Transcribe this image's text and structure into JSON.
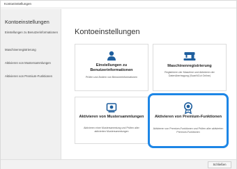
{
  "window": {
    "title": "Kontoeinstellungen"
  },
  "sidebar": {
    "title": "Kontoeinstellungen",
    "items": [
      {
        "label": "Einstellungen zu Benutzerinformationen"
      },
      {
        "label": "Maschinenregistrierung"
      },
      {
        "label": "Aktivieren von Mustersammlungen"
      },
      {
        "label": "Aktivieren von Premium-Funktionen"
      }
    ]
  },
  "main": {
    "title": "Kontoeinstellungen",
    "cards": [
      {
        "icon": "user-icon",
        "title": "Einstellungen zu Benutzerinformationen",
        "desc": "Prüfen und Ändern von Benutzerinformationen"
      },
      {
        "icon": "sewing-machine-icon",
        "title": "Maschinenregistrierung",
        "desc": "Registrieren der Maschine und Aktivieren der Datenübertragung (ScanNCut Online)"
      },
      {
        "icon": "pattern-collection-icon",
        "title": "Aktivieren von Mustersammlungen",
        "desc": "Aktivieren einer Mustersammlung und Prüfen aller aktivierten Mustersammlungen"
      },
      {
        "icon": "premium-badge-icon",
        "title": "Aktivieren von Premium-Funktionen",
        "desc": "Aktivieren von Premium-Funktionen und Prüfen aller aktivierten Premium-Funktionen"
      }
    ]
  },
  "footer": {
    "close_label": "Schließen"
  },
  "colors": {
    "accent": "#1d86e6",
    "icon": "#1f5f9e",
    "sidebar_bg": "#f0f0f0"
  }
}
